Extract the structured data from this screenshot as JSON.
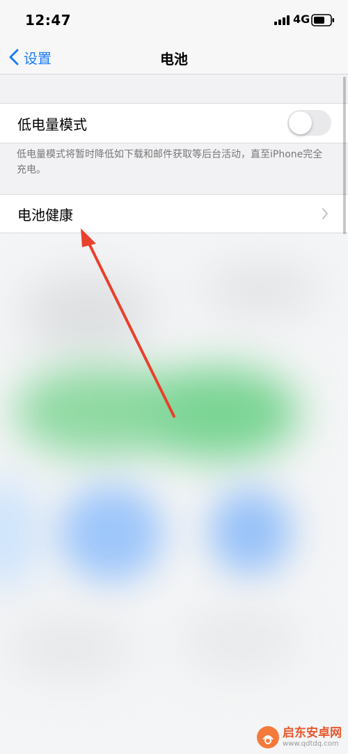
{
  "status_bar": {
    "time": "12:47",
    "network": "4G",
    "icons": [
      "signal-bars-icon",
      "battery-icon"
    ]
  },
  "nav": {
    "back_label": "设置",
    "title": "电池",
    "back_icon": "chevron-left-icon"
  },
  "low_power": {
    "label": "低电量模式",
    "toggle_on": false,
    "footer": "低电量模式将暂时降低如下载和邮件获取等后台活动，直至iPhone完全充电。"
  },
  "battery_health": {
    "label": "电池健康",
    "chevron_icon": "chevron-right-icon"
  },
  "watermark": {
    "name": "启东安卓网",
    "url": "www.qdtdq.com"
  },
  "colors": {
    "accent_blue": "#1a7cf5",
    "arrow_red": "#e8402c",
    "background": "#f2f2f4"
  }
}
